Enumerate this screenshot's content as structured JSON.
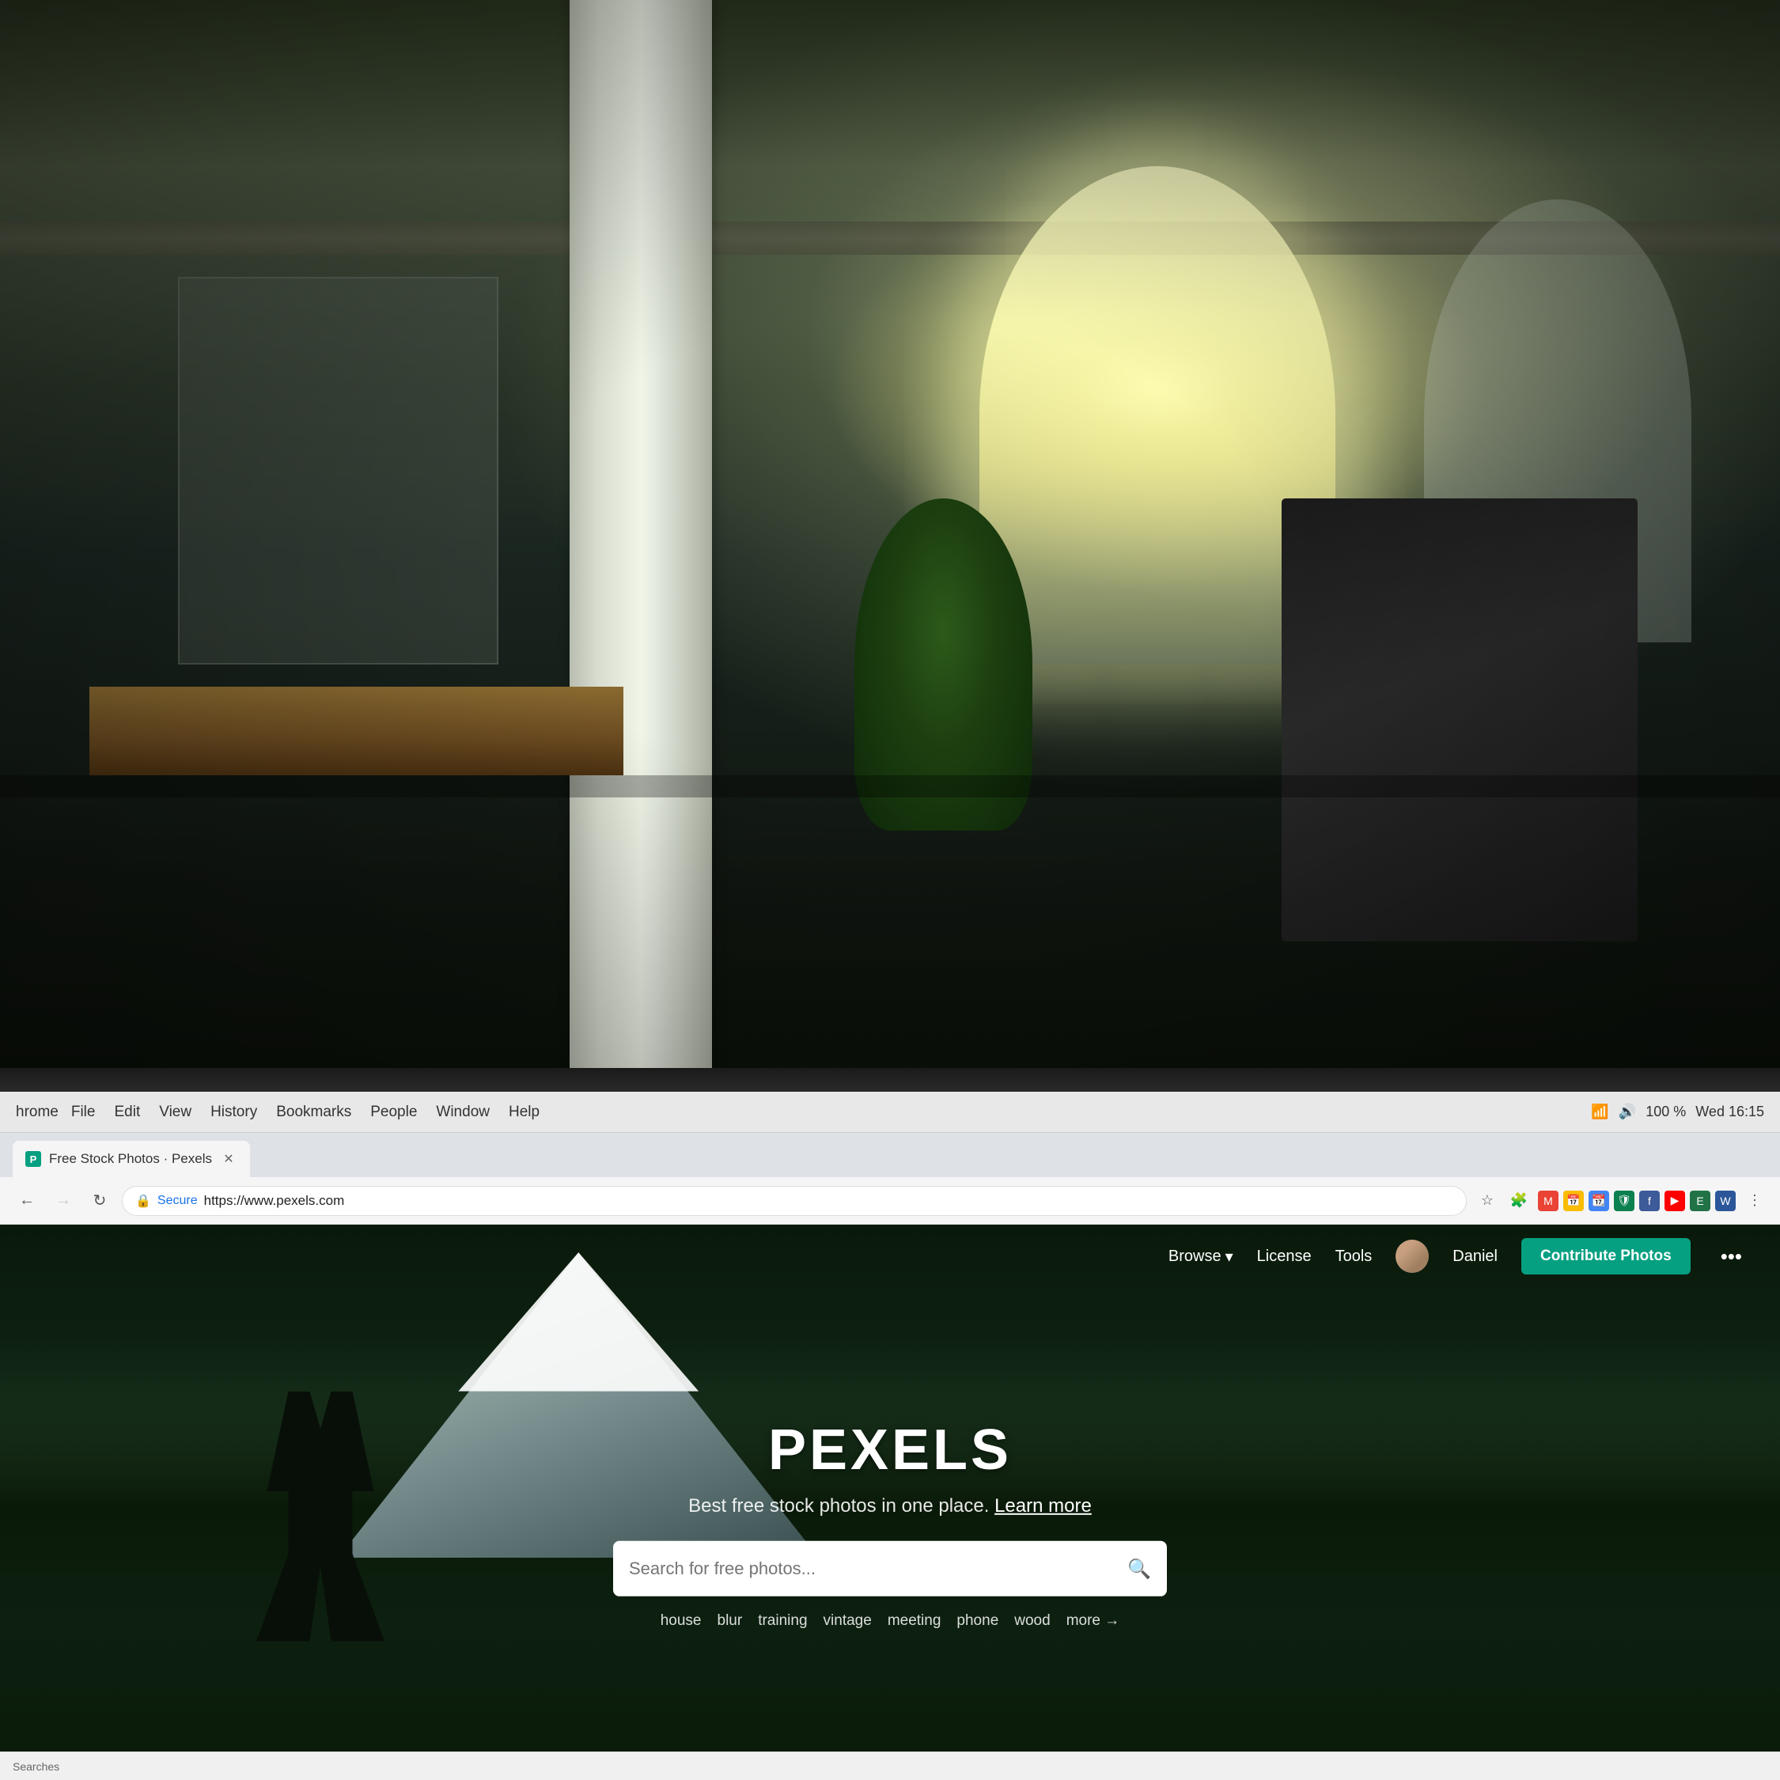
{
  "os": {
    "app_name": "hrome",
    "menu_items": [
      "File",
      "Edit",
      "View",
      "History",
      "Bookmarks",
      "People",
      "Window",
      "Help"
    ],
    "clock": "Wed 16:15",
    "battery": "100 %"
  },
  "browser": {
    "tab": {
      "label": "Free Stock Photos · Pexels",
      "favicon": "P"
    },
    "address": {
      "secure_label": "Secure",
      "url": "https://www.pexels.com"
    }
  },
  "pexels": {
    "nav": {
      "browse_label": "Browse",
      "license_label": "License",
      "tools_label": "Tools",
      "user_name": "Daniel",
      "contribute_label": "Contribute Photos"
    },
    "hero": {
      "title": "PEXELS",
      "subtitle": "Best free stock photos in one place.",
      "learn_more": "Learn more",
      "search_placeholder": "Search for free photos...",
      "popular_searches": [
        "house",
        "blur",
        "training",
        "vintage",
        "meeting",
        "phone",
        "wood"
      ],
      "more_label": "more →"
    }
  }
}
